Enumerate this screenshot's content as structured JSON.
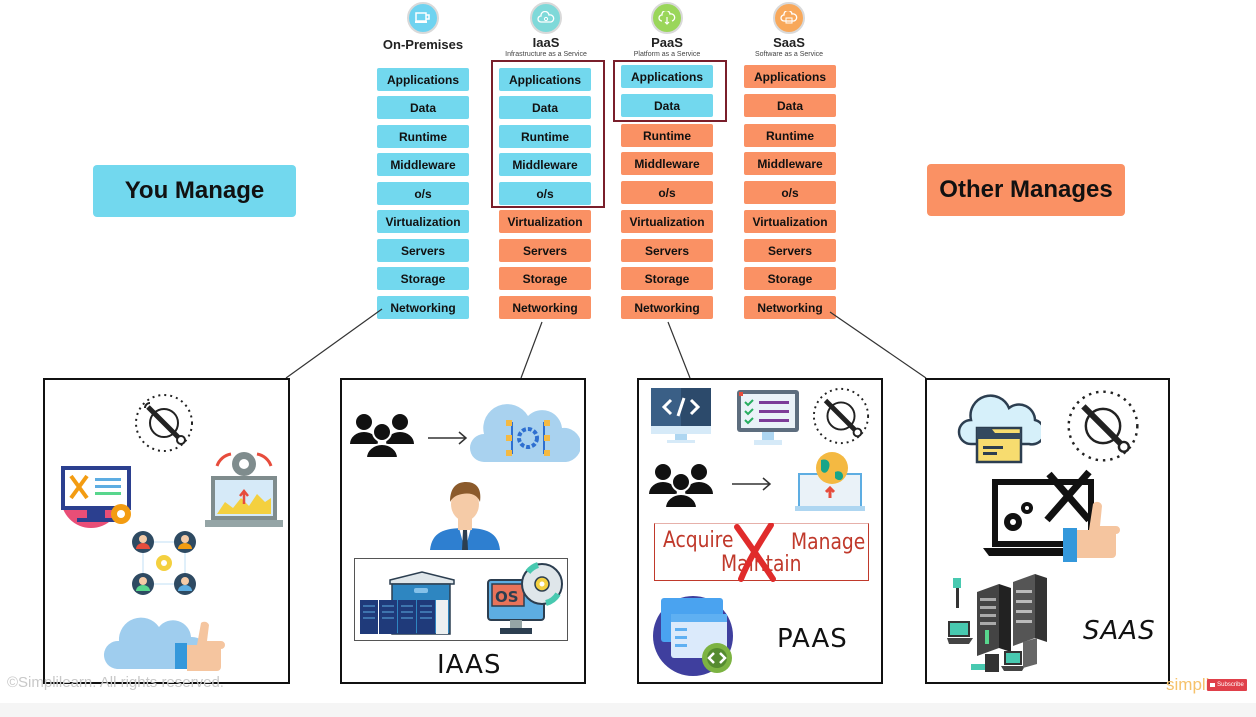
{
  "columns": [
    {
      "id": "on-premises",
      "title": "On-Premises",
      "subtitle": "",
      "icon": "laptop-icon",
      "icon_color": "#6fd3f0",
      "layers": [
        "Applications",
        "Data",
        "Runtime",
        "Middleware",
        "o/s",
        "Virtualization",
        "Servers",
        "Storage",
        "Networking"
      ],
      "you_manage_count": 9
    },
    {
      "id": "iaas",
      "title": "IaaS",
      "subtitle": "Infrastructure as a Service",
      "icon": "cloud-gear-icon",
      "icon_color": "#7fd9d9",
      "layers": [
        "Applications",
        "Data",
        "Runtime",
        "Middleware",
        "o/s",
        "Virtualization",
        "Servers",
        "Storage",
        "Networking"
      ],
      "you_manage_count": 5
    },
    {
      "id": "paas",
      "title": "PaaS",
      "subtitle": "Platform as a Service",
      "icon": "cloud-download-icon",
      "icon_color": "#9ad65a",
      "layers": [
        "Applications",
        "Data",
        "Runtime",
        "Middleware",
        "o/s",
        "Virtualization",
        "Servers",
        "Storage",
        "Networking"
      ],
      "you_manage_count": 2
    },
    {
      "id": "saas",
      "title": "SaaS",
      "subtitle": "Software as a Service",
      "icon": "cloud-app-icon",
      "icon_color": "#f8a85a",
      "layers": [
        "Applications",
        "Data",
        "Runtime",
        "Middleware",
        "o/s",
        "Virtualization",
        "Servers",
        "Storage",
        "Networking"
      ],
      "you_manage_count": 0
    }
  ],
  "legend": {
    "you_manage": "You Manage",
    "other_manages": "Other Manages"
  },
  "colors": {
    "you_manage": "#72d8ee",
    "other_manages": "#fa9164",
    "highlight_frame": "#7a1f2b"
  },
  "panels": {
    "on_premises": {
      "label": ""
    },
    "iaas": {
      "label": "IAAS",
      "os_text": "OS"
    },
    "paas": {
      "label": "PAAS",
      "words": [
        "Acquire",
        "Maintain",
        "Manage"
      ]
    },
    "saas": {
      "label": "SAAS"
    }
  },
  "footer": {
    "copyright": "©Simplilearn. All rights reserved.",
    "brand": "simpli",
    "subscribe": "Subscribe"
  }
}
